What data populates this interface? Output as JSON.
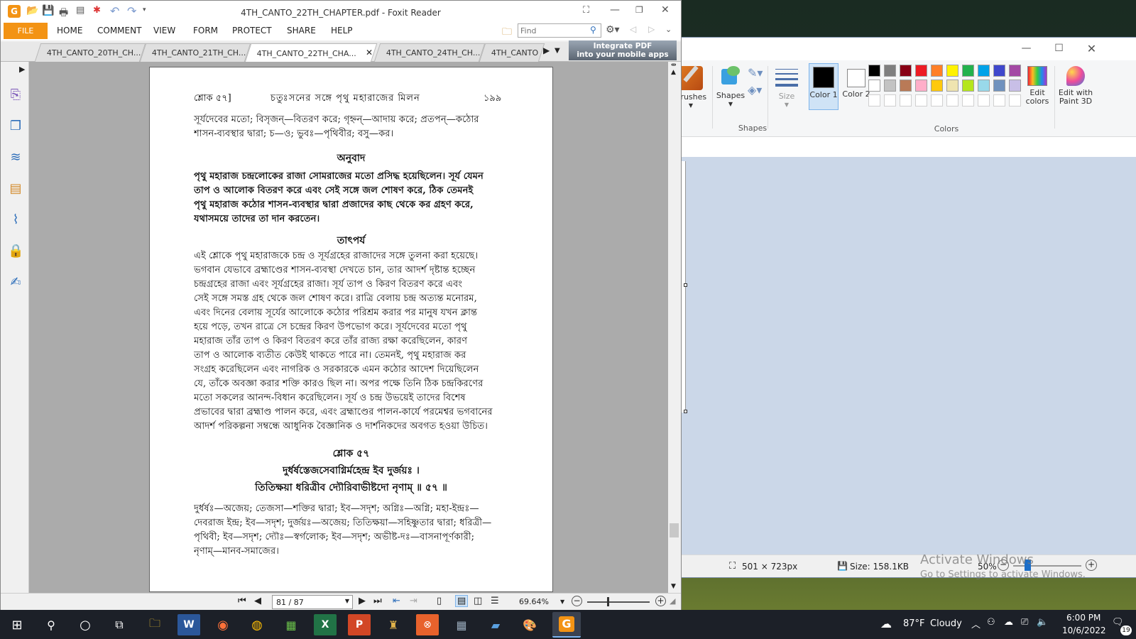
{
  "desktop": {
    "activate_windows_title": "Activate Windows",
    "activate_windows_sub": "Go to Settings to activate Windows."
  },
  "paint": {
    "tools": {
      "brushes_label": "Brushes",
      "shapes_label": "Shapes",
      "size_label": "Size",
      "color1_label": "Color 1",
      "color2_label": "Color 2",
      "edit_colors_label": "Edit colors",
      "edit_3d_label": "Edit with Paint 3D"
    },
    "groups": {
      "shapes": "Shapes",
      "colors": "Colors"
    },
    "palette_row1": [
      "#000000",
      "#7f7f7f",
      "#880015",
      "#ed1c24",
      "#ff7f27",
      "#fff200",
      "#22b14c",
      "#00a2e8",
      "#3f48cc",
      "#a349a4"
    ],
    "palette_row2": [
      "#ffffff",
      "#c3c3c3",
      "#b97a57",
      "#ffaec9",
      "#ffc90e",
      "#efe4b0",
      "#b5e61d",
      "#99d9ea",
      "#7092be",
      "#c8bfe7"
    ],
    "status": {
      "dimensions": "501 × 723px",
      "size": "Size: 158.1KB",
      "zoom": "50%"
    }
  },
  "foxit": {
    "title": "4TH_CANTO_22TH_CHAPTER.pdf - Foxit Reader",
    "menu": {
      "file": "FILE",
      "items": [
        "HOME",
        "COMMENT",
        "VIEW",
        "FORM",
        "PROTECT",
        "SHARE",
        "HELP"
      ]
    },
    "find_placeholder": "Find",
    "tabs": [
      "4TH_CANTO_20TH_CH...",
      "4TH_CANTO_21TH_CH...",
      "4TH_CANTO_22TH_CHA...",
      "4TH_CANTO_24TH_CH...",
      "4TH_CANTO"
    ],
    "ad_line1": "Integrate PDF",
    "ad_line2": "into your mobile apps",
    "page_field": "81 / 87",
    "zoom": "69.64%",
    "page": {
      "header_left": "শ্লোক ৫৭]",
      "header_center": "চতুঃসনের সঙ্গে পৃথু মহারাজের মিলন",
      "header_right": "১৯৯",
      "synonyms_top": [
        "সূর্যদেবের মতো; বিসৃজন্—বিতরণ করে; গৃহ্নন্—আদায় করে; প্রতপন্—কঠোর",
        "শাসন-ব্যবস্থার দ্বারা; চ—ও; ভুবঃ—পৃথিবীর; বসু—কর।"
      ],
      "translation_heading": "অনুবাদ",
      "translation": [
        "পৃথু মহারাজ চন্দ্রলোকের রাজা সোমরাজের মতো প্রসিদ্ধ হয়েছিলেন। সূর্য যেমন",
        "তাপ ও আলোক বিতরণ করে এবং সেই সঙ্গে জল শোষণ করে, ঠিক তেমনই",
        "পৃথু মহারাজ কঠোর শাসন-ব্যবস্থার দ্বারা প্রজাদের কাছ থেকে কর গ্রহণ করে,",
        "যথাসময়ে তাদের তা দান করতেন।"
      ],
      "purport_heading": "তাৎপর্য",
      "purport": [
        "এই শ্লোকে পৃথু মহারাজকে চন্দ্র ও সূর্যগ্রহের রাজাদের সঙ্গে তুলনা করা হয়েছে।",
        "ভগবান যেভাবে ব্রহ্মাণ্ডের শাসন-ব্যবস্থা দেখতে চান, তার আদর্শ দৃষ্টান্ত হচ্ছেন",
        "চন্দ্রগ্রহের রাজা এবং সূর্যগ্রহের রাজা। সূর্য তাপ ও কিরণ বিতরণ করে এবং",
        "সেই সঙ্গে সমস্ত গ্রহ থেকে জল শোষণ করে। রাত্রি বেলায় চন্দ্র অত্যন্ত মনোরম,",
        "এবং দিনের বেলায় সূর্যের আলোকে কঠোর পরিশ্রম করার পর মানুষ যখন ক্লান্ত",
        "হয়ে পড়ে, তখন রাত্রে সে চন্দ্রের কিরণ উপভোগ করে। সূর্যদেবের মতো পৃথু",
        "মহারাজ তাঁর তাপ ও কিরণ বিতরণ করে তাঁর রাজ্য রক্ষা করেছিলেন, কারণ",
        "তাপ ও আলোক ব্যতীত কেউই থাকতে পারে না। তেমনই, পৃথু মহারাজ কর",
        "সংগ্রহ করেছিলেন এবং নাগরিক ও সরকারকে এমন কঠোর আদেশ দিয়েছিলেন",
        "যে, তাঁকে অবজ্ঞা করার শক্তি কারও ছিল না। অপর পক্ষে তিনি ঠিক চন্দ্রকিরণের",
        "মতো সকলের আনন্দ-বিধান করেছিলেন। সূর্য ও চন্দ্র উভয়েই তাদের বিশেষ",
        "প্রভাবের দ্বারা ব্রহ্মাণ্ড পালন করে, এবং ব্রহ্মাণ্ডের পালন-কার্যে পরমেশ্বর ভগবানের",
        "আদর্শ পরিকল্পনা সম্বন্ধে আধুনিক বৈজ্ঞানিক ও দার্শনিকদের অবগত হওয়া উচিত।"
      ],
      "verse_heading": "শ্লোক ৫৭",
      "verse": [
        "দুর্ধর্ষস্তেজসেবাগ্নির্মহেন্দ্র ইব দুর্জয়ঃ ।",
        "তিতিক্ষয়া ধরিত্রীব দ্যৌরিবাভীষ্টদো নৃণাম্ ॥ ৫৭ ॥"
      ],
      "synonyms_bottom": [
        "দুর্ধর্ষঃ—অজেয়; তেজসা—শক্তির দ্বারা; ইব—সদৃশ; অগ্নিঃ—অগ্নি; মহা-ইন্দ্রঃ—",
        "দেবরাজ ইন্দ্র; ইব—সদৃশ; দুর্জয়ঃ—অজেয়; তিতিক্ষয়া—সহিষ্ণুতার দ্বারা; ধরিত্রী—",
        "পৃথিবী; ইব—সদৃশ; দ্যৌঃ—স্বর্গলোক; ইব—সদৃশ; অভীষ্ট-দঃ—বাসনাপূর্ণকারী;",
        "নৃণাম্—মানব-সমাজের।"
      ]
    }
  },
  "taskbar": {
    "weather_temp": "87°F",
    "weather_text": "Cloudy",
    "time": "6:00 PM",
    "date": "10/6/2022",
    "notifications": "19"
  }
}
